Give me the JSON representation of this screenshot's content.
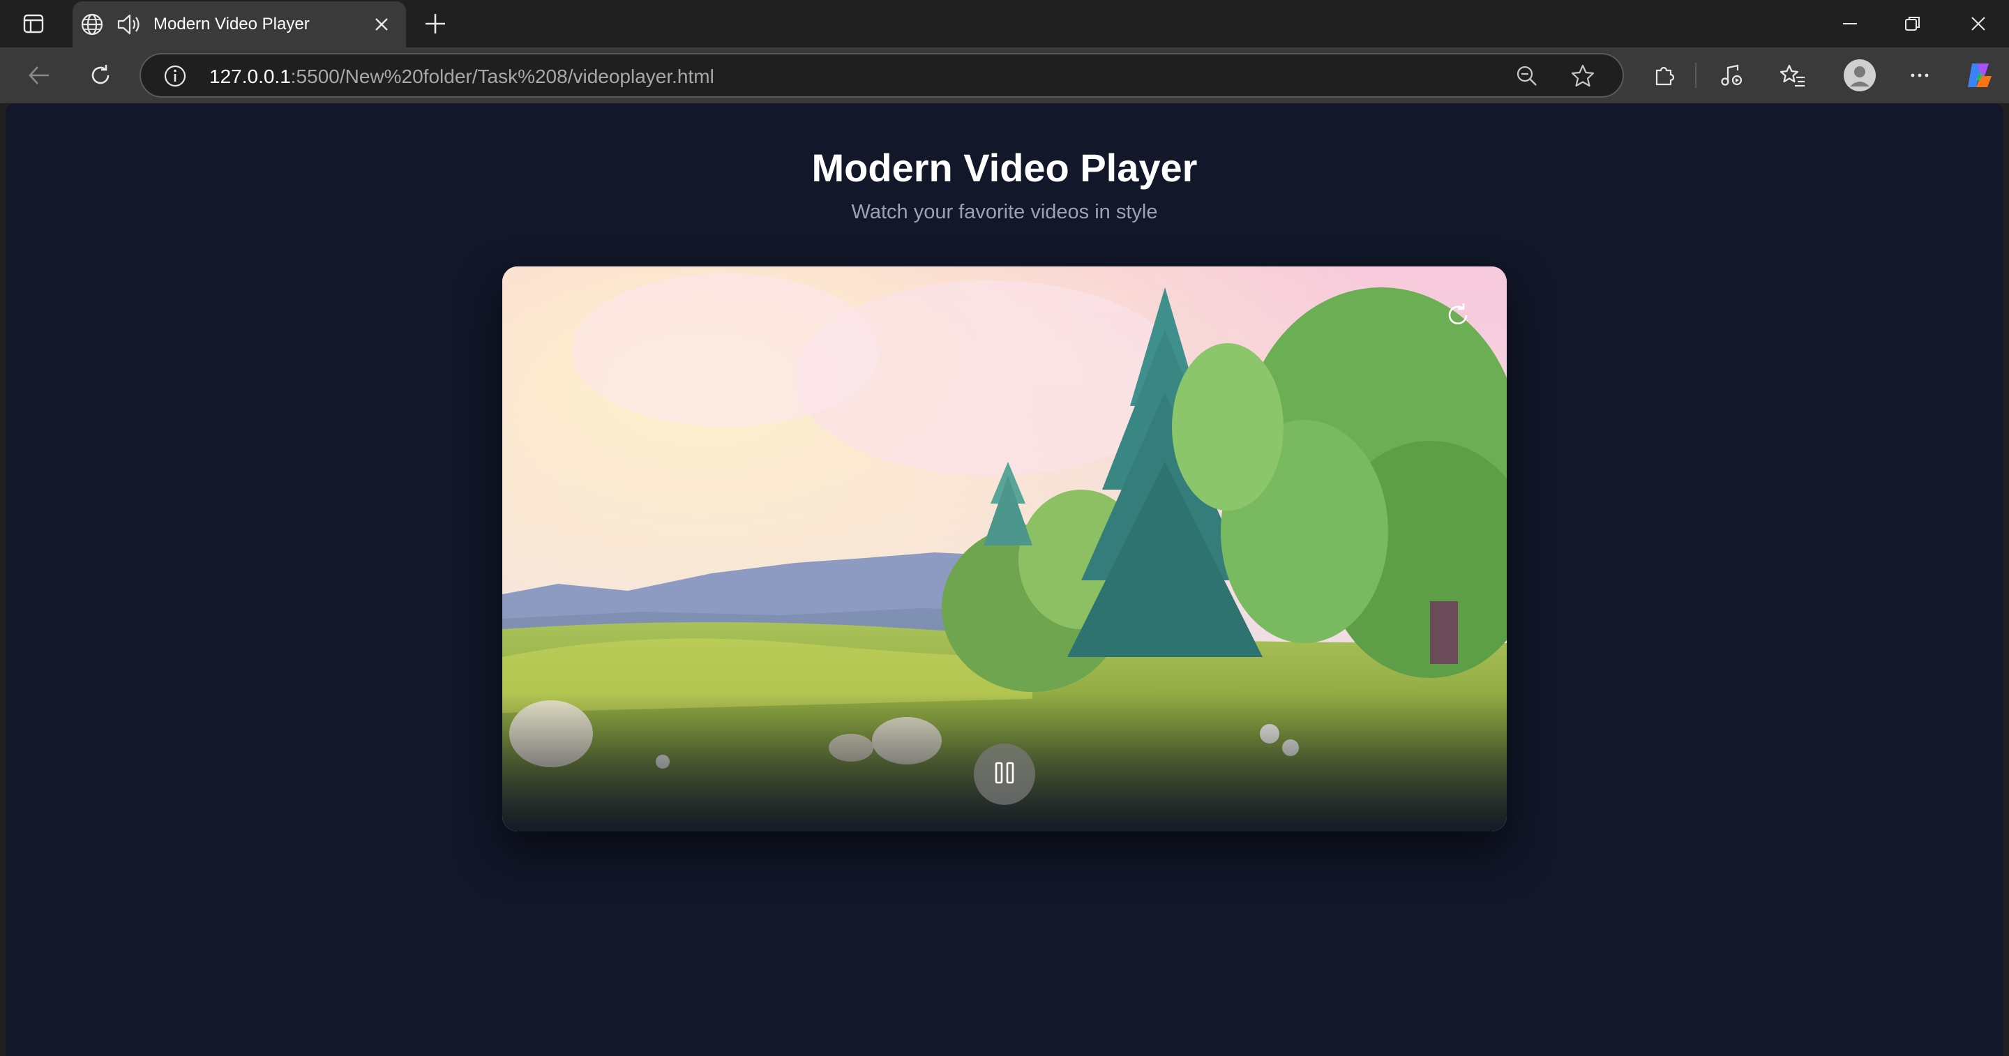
{
  "browser": {
    "tab": {
      "title": "Modern Video Player",
      "icons": [
        "globe-icon",
        "speaker-icon",
        "close-icon"
      ]
    },
    "address_bar": {
      "url_host": "127.0.0.1",
      "url_rest": ":5500/New%20folder/Task%208/videoplayer.html"
    },
    "toolbar_icons": [
      "back-icon",
      "refresh-icon",
      "info-icon",
      "zoom-out-icon",
      "favorite-star-icon",
      "extensions-icon",
      "media-control-icon",
      "favorites-icon",
      "profile-icon",
      "more-icon",
      "copilot-icon"
    ],
    "window_controls": [
      "minimize-icon",
      "restore-icon",
      "close-icon"
    ]
  },
  "page": {
    "title": "Modern Video Player",
    "subtitle": "Watch your favorite videos in style"
  },
  "player": {
    "controls": {
      "replay_icon": "replay-icon",
      "center_icon": "pause-icon"
    }
  },
  "colors": {
    "page_background": "#121729",
    "browser_frame": "#202020",
    "toolbar": "#3a3a3a",
    "title_text": "#ffffff",
    "subtitle_text": "#9aa3b5"
  }
}
